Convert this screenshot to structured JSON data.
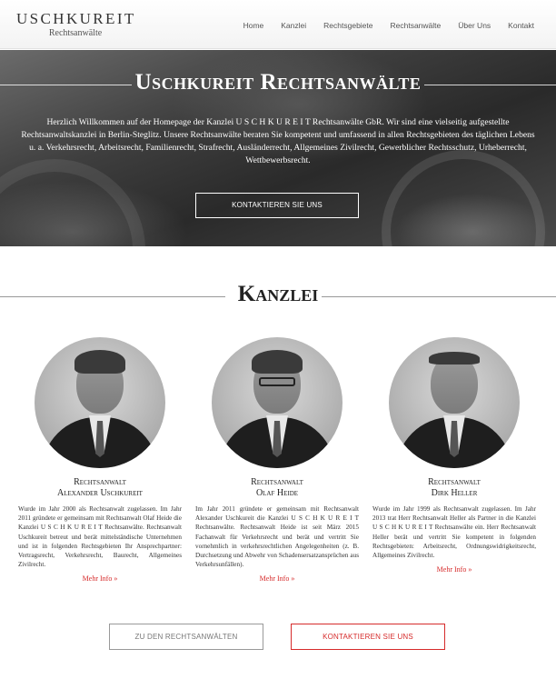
{
  "header": {
    "logo_main": "USCHKUREIT",
    "logo_sub": "Rechtsanwälte",
    "nav": [
      "Home",
      "Kanzlei",
      "Rechtsgebiete",
      "Rechtsanwälte",
      "Über Uns",
      "Kontakt"
    ]
  },
  "hero": {
    "title": "Uschkureit Rechtsanwälte",
    "text": "Herzlich Willkommen auf der Homepage der Kanzlei U S C H K U R E I T Rechtsanwälte GbR. Wir sind eine vielseitig aufgestellte Rechtsanwaltskanzlei in Berlin-Steglitz. Unsere Rechtsanwälte beraten Sie kompetent und umfassend in allen Rechtsgebieten des täglichen Lebens u. a. Verkehrsrecht, Arbeitsrecht, Familienrecht, Strafrecht, Ausländerrecht, Allgemeines Zivilrecht, Gewerblicher Rechtsschutz, Urheberrecht, Wettbewerbsrecht.",
    "button": "KONTAKTIEREN SIE UNS"
  },
  "section": {
    "title": "Kanzlei"
  },
  "members": [
    {
      "role": "Rechtsanwalt",
      "name": "Alexander Uschkureit",
      "bio": "Wurde im Jahr 2000 als Rechtsanwalt zugelassen. Im Jahr 2011 gründete er gemeinsam mit Rechtsanwalt Olaf Heide die Kanzlei U S C H K U R E I T Rechtsanwälte. Rechtsanwalt Uschkureit betreut und berät mittelständische Unternehmen und ist in folgenden Rechtsgebieten Ihr Ansprechpartner: Vertragsrecht, Verkehrsrecht, Baurecht, Allgemeines Zivilrecht.",
      "more": "Mehr Info »"
    },
    {
      "role": "Rechtsanwalt",
      "name": "Olaf Heide",
      "bio": "Im Jahr 2011 gründete er gemeinsam mit Rechtsanwalt Alexander Uschkureit die Kanzlei U S C H K U R E I T Rechtsanwälte. Rechtsanwalt Heide ist seit März 2015 Fachanwalt für Verkehrsrecht und berät und vertritt Sie vornehmlich in verkehrsrechtlichen Angelegenheiten (z. B. Durchsetzung und Abwehr von Schadensersatzansprüchen aus Verkehrsunfällen).",
      "more": "Mehr Info »"
    },
    {
      "role": "Rechtsanwalt",
      "name": "Dirk Heller",
      "bio": "Wurde im Jahr 1999 als Rechtsanwalt zugelassen. Im Jahr 2013 trat Herr Rechtsanwalt Heller als Partner in die Kanzlei U S C H K U R E I T Rechtsanwälte ein. Herr Rechtsanwalt Heller berät und vertritt Sie kompetent in folgenden Rechtsgebieten: Arbeitsrecht, Ordnungswidrigkeitsrecht, Allgemeines Zivilrecht.",
      "more": "Mehr Info »"
    }
  ],
  "buttons": {
    "lawyers": "ZU DEN RECHTSANWÄLTEN",
    "contact": "KONTAKTIEREN SIE UNS"
  },
  "colors": {
    "accent": "#d62b2b",
    "text": "#333333",
    "gray_button": "#999999"
  }
}
